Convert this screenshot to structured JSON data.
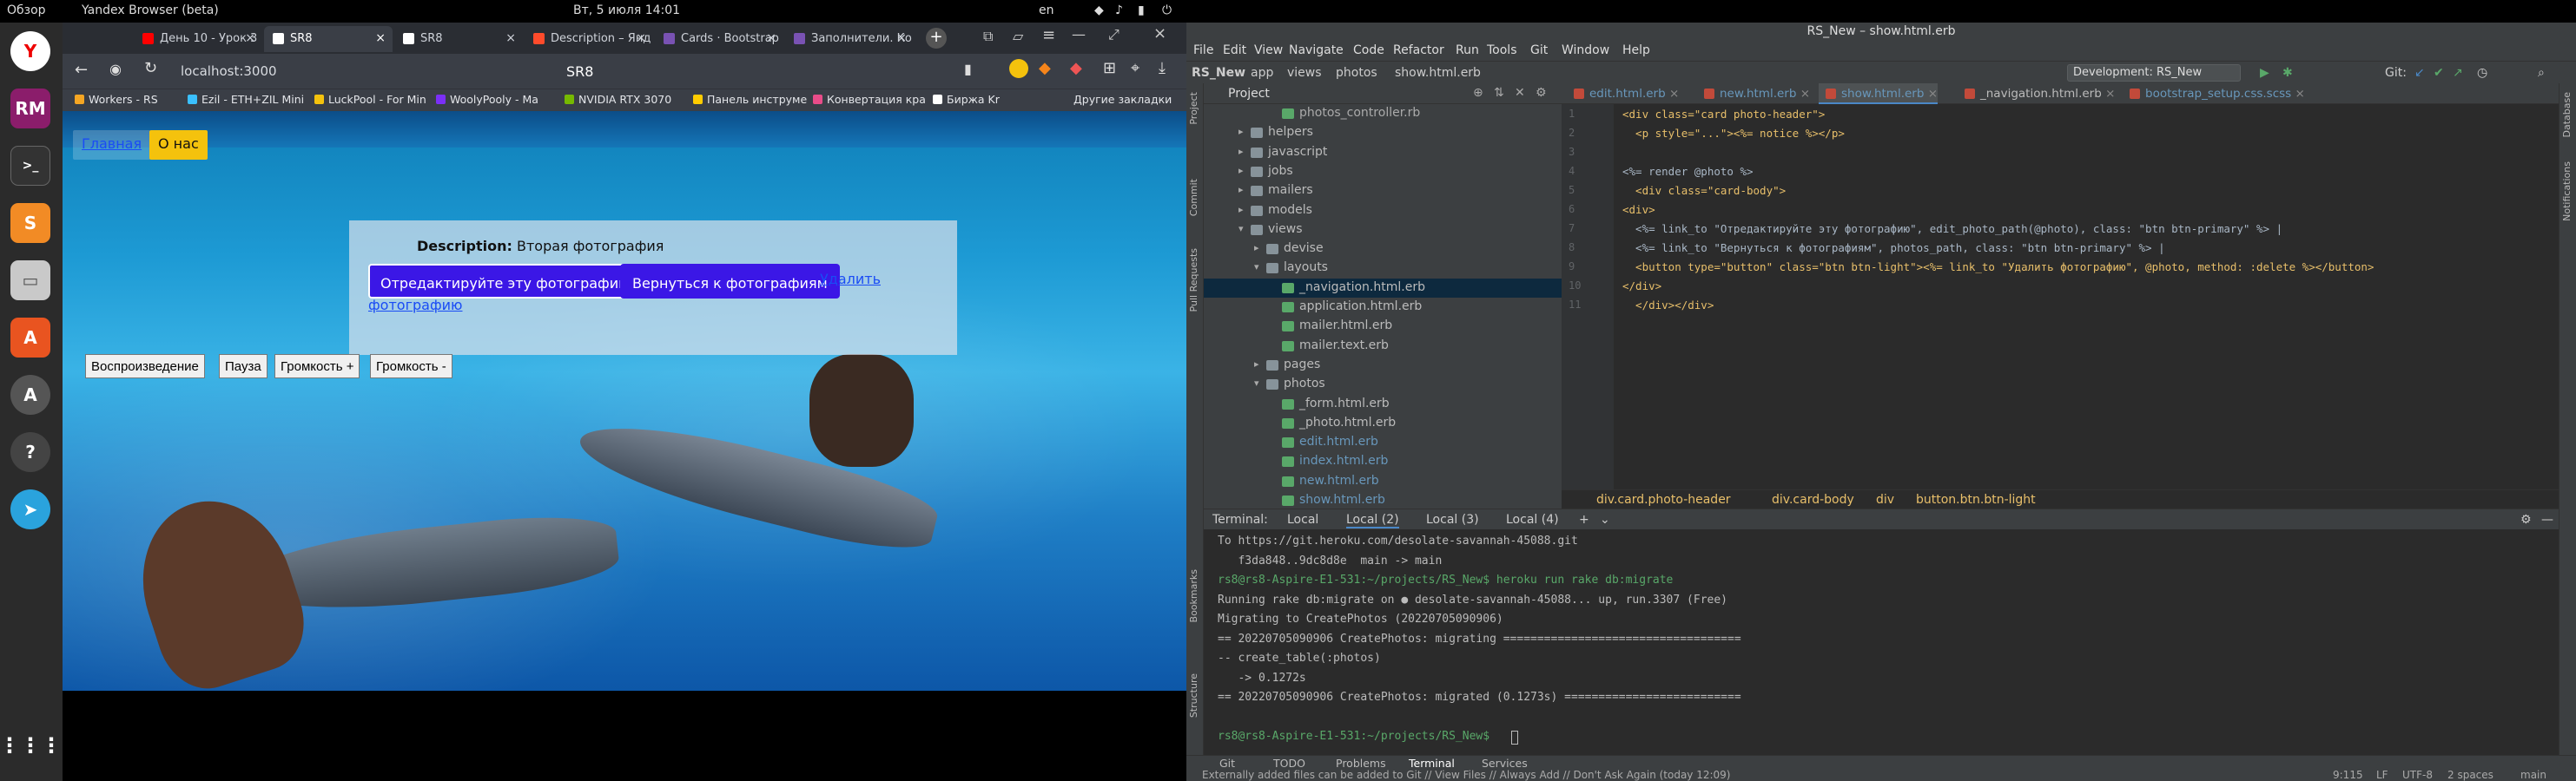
{
  "topbar": {
    "overview": "Обзор",
    "browser_app": "Yandex Browser (beta)",
    "clock": "Вт, 5 июля  14:01",
    "lang": "en"
  },
  "browser": {
    "tabs": [
      {
        "title": "День 10 - Урок 3",
        "color": "#ff0000"
      },
      {
        "title": "SR8",
        "color": "#ffffff"
      },
      {
        "title": "SR8",
        "color": "#ffffff"
      },
      {
        "title": "Description – Янд",
        "color": "#ff4b2b"
      },
      {
        "title": "Cards · Bootstrap",
        "color": "#7952b3"
      },
      {
        "title": "Заполнители. Ко",
        "color": "#7952b3"
      }
    ],
    "url": "localhost:3000",
    "page_title": "SR8",
    "bookmarks": [
      {
        "label": "Workers - RS",
        "color": "#f5a623"
      },
      {
        "label": "Ezil - ETH+ZIL Mini",
        "color": "#3ac0ff"
      },
      {
        "label": "LuckPool - For Min",
        "color": "#f4c20d"
      },
      {
        "label": "WoolyPooly - Ma",
        "color": "#7b2ff7"
      },
      {
        "label": "NVIDIA RTX 3070",
        "color": "#76b900"
      },
      {
        "label": "Панель инструме",
        "color": "#ffcc00"
      },
      {
        "label": "Конвертация кра",
        "color": "#e94c89"
      },
      {
        "label": "Биржа Kr",
        "color": "#ffffff"
      }
    ],
    "other_bookmarks": "Другие закладки"
  },
  "page": {
    "nav": {
      "home": "Главная",
      "about": "О нас"
    },
    "description_label": "Description:",
    "description_value": "Вторая фотография",
    "edit_button": "Отредактируйте эту фотографию",
    "back_button": "Вернуться к фотографиям",
    "delete_link_a": "Удалить",
    "delete_link_b": "фотографию",
    "controls": {
      "play": "Воспроизведение",
      "pause": "Пауза",
      "vol_up": "Громкость +",
      "vol_down": "Громкость -"
    }
  },
  "ide": {
    "title": "RS_New – show.html.erb",
    "menu": [
      "File",
      "Edit",
      "View",
      "Navigate",
      "Code",
      "Refactor",
      "Run",
      "Tools",
      "Git",
      "Window",
      "Help"
    ],
    "breadcrumb_path": [
      "RS_New",
      "app",
      "views",
      "photos",
      "show.html.erb"
    ],
    "run_config": "Development: RS_New",
    "git_label": "Git:",
    "project_label": "Project",
    "tree": [
      {
        "label": "photos_controller.rb",
        "depth": 4,
        "type": "file",
        "color": "#aaa"
      },
      {
        "label": "helpers",
        "depth": 2,
        "type": "folder"
      },
      {
        "label": "javascript",
        "depth": 2,
        "type": "folder"
      },
      {
        "label": "jobs",
        "depth": 2,
        "type": "folder"
      },
      {
        "label": "mailers",
        "depth": 2,
        "type": "folder"
      },
      {
        "label": "models",
        "depth": 2,
        "type": "folder"
      },
      {
        "label": "views",
        "depth": 2,
        "type": "folder",
        "open": true
      },
      {
        "label": "devise",
        "depth": 3,
        "type": "folder"
      },
      {
        "label": "layouts",
        "depth": 3,
        "type": "folder",
        "open": true
      },
      {
        "label": "_navigation.html.erb",
        "depth": 4,
        "type": "file",
        "selected": true
      },
      {
        "label": "application.html.erb",
        "depth": 4,
        "type": "file"
      },
      {
        "label": "mailer.html.erb",
        "depth": 4,
        "type": "file"
      },
      {
        "label": "mailer.text.erb",
        "depth": 4,
        "type": "file"
      },
      {
        "label": "pages",
        "depth": 3,
        "type": "folder"
      },
      {
        "label": "photos",
        "depth": 3,
        "type": "folder",
        "open": true
      },
      {
        "label": "_form.html.erb",
        "depth": 4,
        "type": "file"
      },
      {
        "label": "_photo.html.erb",
        "depth": 4,
        "type": "file"
      },
      {
        "label": "edit.html.erb",
        "depth": 4,
        "type": "file",
        "color": "#6897bb"
      },
      {
        "label": "index.html.erb",
        "depth": 4,
        "type": "file",
        "color": "#6897bb"
      },
      {
        "label": "new.html.erb",
        "depth": 4,
        "type": "file",
        "color": "#6897bb"
      },
      {
        "label": "show.html.erb",
        "depth": 4,
        "type": "file",
        "color": "#6897bb"
      }
    ],
    "editor_tabs": [
      {
        "label": "edit.html.erb",
        "color": "#6897bb"
      },
      {
        "label": "new.html.erb",
        "color": "#6897bb"
      },
      {
        "label": "show.html.erb",
        "color": "#6897bb",
        "active": true
      },
      {
        "label": "_navigation.html.erb",
        "color": "#bbbbbb"
      },
      {
        "label": "bootstrap_setup.css.scss",
        "color": "#6897bb"
      }
    ],
    "code_lines": [
      "<div class=\"card photo-header\">",
      "  <p style=\"...\"><%= notice %></p>",
      "",
      "<%= render @photo %>",
      "  <div class=\"card-body\">",
      "<div>",
      "  <%= link_to \"Отредактируйте эту фотографию\", edit_photo_path(@photo), class: \"btn btn-primary\" %> |",
      "  <%= link_to \"Вернуться к фотографиям\", photos_path, class: \"btn btn-primary\" %> |",
      "  <button type=\"button\" class=\"btn btn-light\"><%= link_to \"Удалить фотографию\", @photo, method: :delete %></button>",
      "</div>",
      "  </div></div>"
    ],
    "code_crumbs": [
      "div.card.photo-header",
      "div.card-body",
      "div",
      "button.btn.btn-light"
    ],
    "terminal_tabs": [
      "Terminal:",
      "Local",
      "Local (2)",
      "Local (3)",
      "Local (4)"
    ],
    "terminal_lines": [
      "To https://git.heroku.com/desolate-savannah-45088.git",
      "   f3da848..9dc8d8e  main -> main",
      "rs8@rs8-Aspire-E1-531:~/projects/RS_New$ heroku run rake db:migrate",
      "Running rake db:migrate on ● desolate-savannah-45088... up, run.3307 (Free)",
      "Migrating to CreatePhotos (20220705090906)",
      "== 20220705090906 CreatePhotos: migrating ===================================",
      "-- create_table(:photos)",
      "   -> 0.1272s",
      "== 20220705090906 CreatePhotos: migrated (0.1273s) ==========================",
      "",
      "rs8@rs8-Aspire-E1-531:~/projects/RS_New$ "
    ],
    "tool_tabs": [
      "Git",
      "TODO",
      "Problems",
      "Terminal",
      "Services"
    ],
    "status_msg": "Externally added files can be added to Git // View Files // Always Add // Don't Ask Again (today 12:09)",
    "status_right": [
      "9:115",
      "LF",
      "UTF-8",
      "2 spaces",
      "main"
    ],
    "left_strip": [
      "Project",
      "Commit",
      "Pull Requests",
      "Bookmarks",
      "Structure"
    ],
    "right_strip": [
      "Database",
      "Notifications"
    ]
  }
}
